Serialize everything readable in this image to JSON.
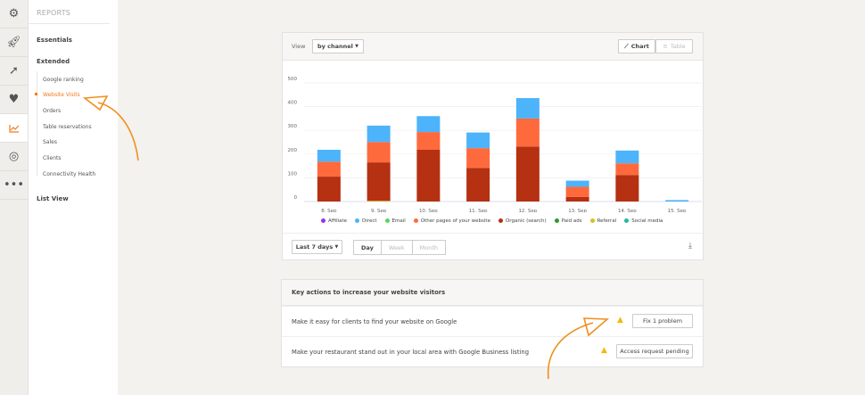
{
  "rail": {
    "icons": [
      "gears-icon",
      "rocket-icon",
      "arrow-circle-icon",
      "heart-pulse-icon",
      "chart-line-icon",
      "target-icon",
      "more-icon"
    ],
    "active": 4
  },
  "nav": {
    "header": "REPORTS",
    "essentials": "Essentials",
    "extended": "Extended",
    "items": [
      "Google ranking",
      "Website Visits",
      "Orders",
      "Table reservations",
      "Sales",
      "Clients",
      "Connectivity Health"
    ],
    "active": 1,
    "list_view": "List View"
  },
  "chart_card": {
    "view_label": "View",
    "view_select": "by channel",
    "chart_tab": "Chart",
    "table_tab": "Table",
    "range_select": "Last 7 days",
    "granularity": [
      "Day",
      "Week",
      "Month"
    ],
    "granularity_active": "Day"
  },
  "chart_data": {
    "type": "bar",
    "stacked": true,
    "categories": [
      "8. Sep",
      "9. Sep",
      "10. Sep",
      "11. Sep",
      "12. Sep",
      "13. Sep",
      "14. Sep",
      "15. Sep"
    ],
    "ylim": [
      0,
      500
    ],
    "yticks": [
      0,
      100,
      200,
      300,
      400,
      500
    ],
    "grid": true,
    "legend_position": "bottom",
    "series": [
      {
        "name": "Affiliate",
        "color": "#9b30e8",
        "values": [
          0,
          0,
          0,
          0,
          0,
          0,
          0,
          0
        ]
      },
      {
        "name": "Direct",
        "color": "#4db3fb",
        "values": [
          50,
          69,
          67,
          66,
          86,
          26,
          54,
          6
        ]
      },
      {
        "name": "Email",
        "color": "#5ad65a",
        "values": [
          0,
          0,
          0,
          0,
          0,
          0,
          0,
          0
        ]
      },
      {
        "name": "Other pages of your website",
        "color": "#ff6a3d",
        "values": [
          63,
          86,
          75,
          83,
          118,
          43,
          49,
          0
        ]
      },
      {
        "name": "Organic (search)",
        "color": "#b53111",
        "values": [
          105,
          162,
          218,
          142,
          232,
          19,
          112,
          0
        ]
      },
      {
        "name": "Paid ads",
        "color": "#2a9a2a",
        "values": [
          0,
          0,
          0,
          0,
          0,
          0,
          0,
          0
        ]
      },
      {
        "name": "Referral",
        "color": "#d4c21f",
        "values": [
          0,
          3,
          0,
          0,
          0,
          0,
          0,
          0
        ]
      },
      {
        "name": "Social media",
        "color": "#1fb8a0",
        "values": [
          0,
          0,
          0,
          0,
          0,
          0,
          0,
          0
        ]
      }
    ],
    "stack_order": [
      "Referral",
      "Organic (search)",
      "Other pages of your website",
      "Direct"
    ]
  },
  "actions": {
    "title": "Key actions to increase your website visitors",
    "rows": [
      {
        "text": "Make it easy for clients to find your website on Google",
        "button": "Fix 1 problem"
      },
      {
        "text": "Make your restaurant stand out in your local area with Google Business listing",
        "button": "Access request pending"
      }
    ]
  },
  "colors": {
    "accent": "#f07a1f",
    "warning": "#f2b90f"
  }
}
